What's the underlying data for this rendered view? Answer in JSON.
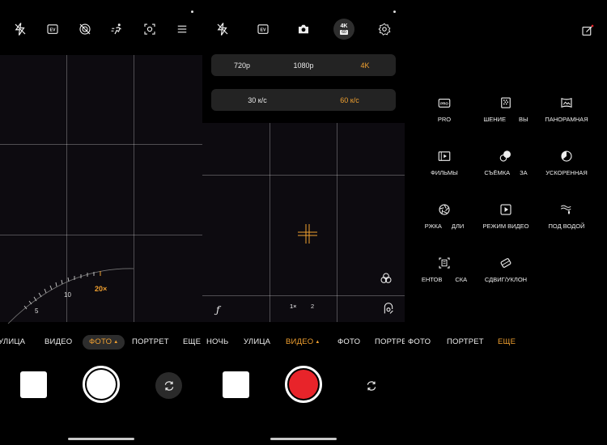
{
  "screen_photo": {
    "toolbar": {
      "flash_icon": "flash-off-icon",
      "ev_label": "EV",
      "icons": [
        "flash-off-icon",
        "ev-icon",
        "live-photo-off-icon",
        "motion-icon",
        "macro-icon",
        "menu-icon"
      ]
    },
    "zoom": {
      "ticks": [
        "5",
        "10",
        "20×"
      ],
      "active": "20×"
    },
    "modes": [
      {
        "label": "УЛИЦА"
      },
      {
        "label": "ВИДЕО"
      },
      {
        "label": "ФОТО",
        "active": true
      },
      {
        "label": "ПОРТРЕТ"
      },
      {
        "label": "ЕЩЕ"
      }
    ]
  },
  "screen_video": {
    "toolbar": {
      "ev_label": "EV",
      "badge_label": "4K",
      "badge_sub": "60"
    },
    "resolution": {
      "options": [
        "720p",
        "1080p",
        "4K"
      ],
      "selected": "4K"
    },
    "framerate": {
      "options": [
        "30 к/с",
        "60 к/с"
      ],
      "selected": "60 к/с"
    },
    "overlay": {
      "aperture_label": "ƒ",
      "zoom_1": "1×",
      "zoom_2": "2"
    },
    "modes": [
      {
        "label": "НОЧЬ"
      },
      {
        "label": "УЛИЦА"
      },
      {
        "label": "ВИДЕО",
        "active": true
      },
      {
        "label": "ФОТО"
      },
      {
        "label": "ПОРТРЕ"
      }
    ]
  },
  "screen_more": {
    "items": [
      {
        "label": "PRO",
        "icon": "pro-mode-icon"
      },
      {
        "label": "ШЕНИЕ",
        "extra": "ВЫ",
        "icon": "highres-icon"
      },
      {
        "label": "ПАНОРАМНАЯ",
        "icon": "panorama-icon"
      },
      {
        "label": "ФИЛЬМЫ",
        "icon": "film-icon"
      },
      {
        "label": "СЪЁМКА",
        "extra": "ЗА",
        "icon": "dual-view-icon"
      },
      {
        "label": "УСКОРЕННАЯ",
        "icon": "timelapse-icon"
      },
      {
        "label": "РЖКА",
        "extra": "ДЛИ",
        "icon": "long-exposure-icon"
      },
      {
        "label": "РЕЖИМ ВИДЕО",
        "icon": "video-mode-icon"
      },
      {
        "label": "ПОД ВОДОЙ",
        "icon": "underwater-icon"
      },
      {
        "label": "ЕНТОВ",
        "extra": "СКА",
        "icon": "document-scan-icon"
      },
      {
        "label": "СДВИГ/УКЛОН",
        "icon": "tilt-shift-icon"
      }
    ],
    "modes": [
      {
        "label": "ФОТО"
      },
      {
        "label": "ПОРТРЕТ"
      },
      {
        "label": "ЕЩЕ",
        "active": true
      }
    ]
  },
  "colors": {
    "accent": "#f0a030",
    "record": "#e8242a",
    "pill_bg": "#232323"
  }
}
